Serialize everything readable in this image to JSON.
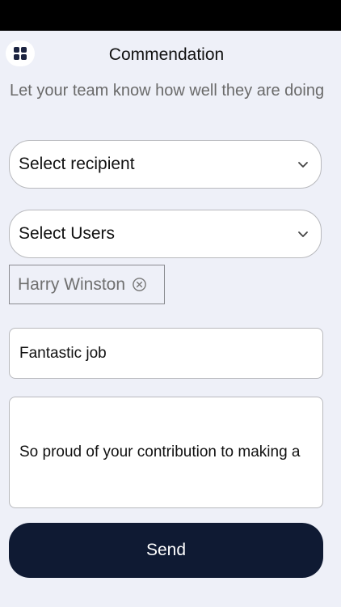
{
  "header": {
    "title": "Commendation",
    "menu_icon": "grid-icon"
  },
  "subtitle": "Let your team know how well they are doing",
  "recipient_select": {
    "placeholder": "Select recipient"
  },
  "users_select": {
    "placeholder": "Select Users",
    "selected": [
      {
        "name": "Harry Winston"
      }
    ]
  },
  "title_field": {
    "value": "Fantastic job"
  },
  "message_field": {
    "value": "So proud of your contribution to making a"
  },
  "send_button": {
    "label": "Send"
  }
}
